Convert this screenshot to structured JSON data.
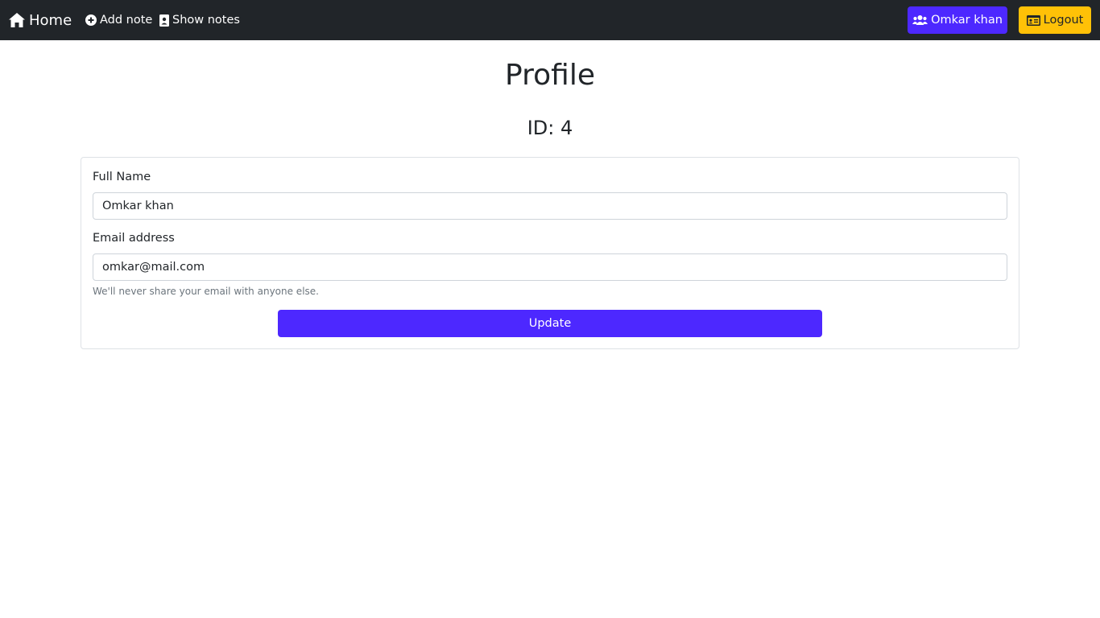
{
  "navbar": {
    "brand": {
      "label": "Home",
      "icon": "house-icon"
    },
    "links": [
      {
        "label": "Add note",
        "icon": "plus-circle-icon"
      },
      {
        "label": "Show notes",
        "icon": "id-badge-icon"
      }
    ],
    "user_button": {
      "label": "Omkar khan",
      "icon": "users-icon"
    },
    "logout_button": {
      "label": "Logout",
      "icon": "id-card-icon"
    },
    "colors": {
      "background": "#212529",
      "user": "#4d28ff",
      "logout": "#ffc107"
    }
  },
  "page": {
    "title": "Profile",
    "subtitle": "ID: 4"
  },
  "form": {
    "name_label": "Full Name",
    "name_value": "Omkar khan",
    "email_label": "Email address",
    "email_value": "omkar@mail.com",
    "help_text": "We'll never share your email with anyone else.",
    "submit_label": "Update",
    "accent_color": "#4d28ff"
  }
}
